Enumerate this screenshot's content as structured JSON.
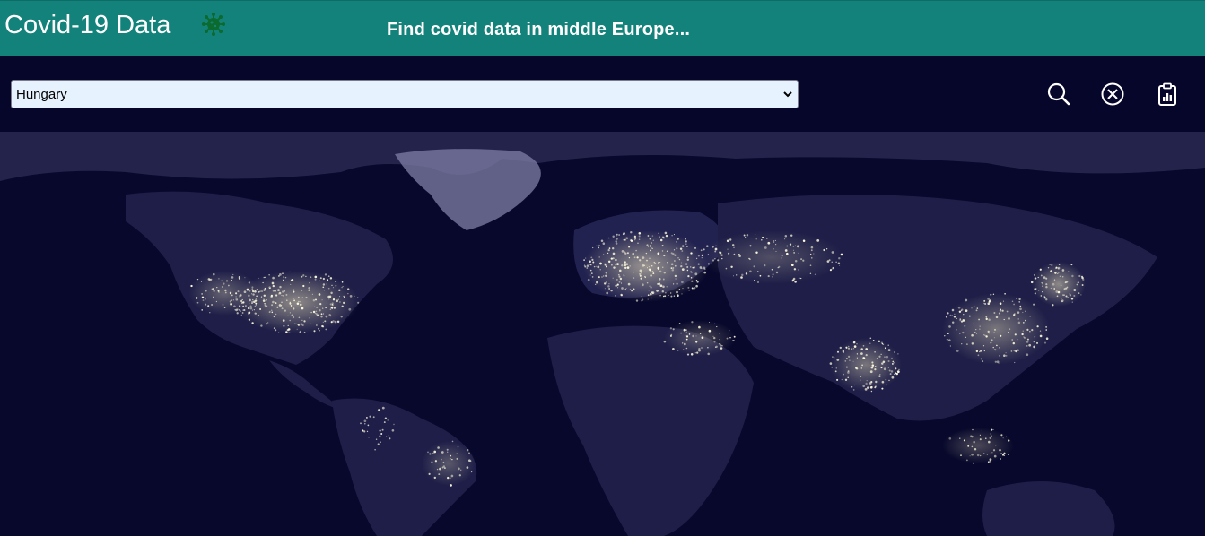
{
  "header": {
    "title": "Covid-19 Data",
    "tagline": "Find covid data in middle Europe..."
  },
  "toolbar": {
    "country_select": {
      "selected": "Hungary",
      "options": [
        "Hungary"
      ]
    },
    "buttons": [
      {
        "name": "search",
        "icon": "search-icon"
      },
      {
        "name": "clear",
        "icon": "close-circle-icon"
      },
      {
        "name": "report",
        "icon": "clipboard-chart-icon"
      }
    ]
  },
  "colors": {
    "header_bg": "#13827b",
    "page_bg": "#06062a",
    "select_bg": "#e6f3ff",
    "virus_icon": "#0b6b2e",
    "city_lights": "#fff6c8"
  },
  "map": {
    "type": "world-night-lights"
  }
}
